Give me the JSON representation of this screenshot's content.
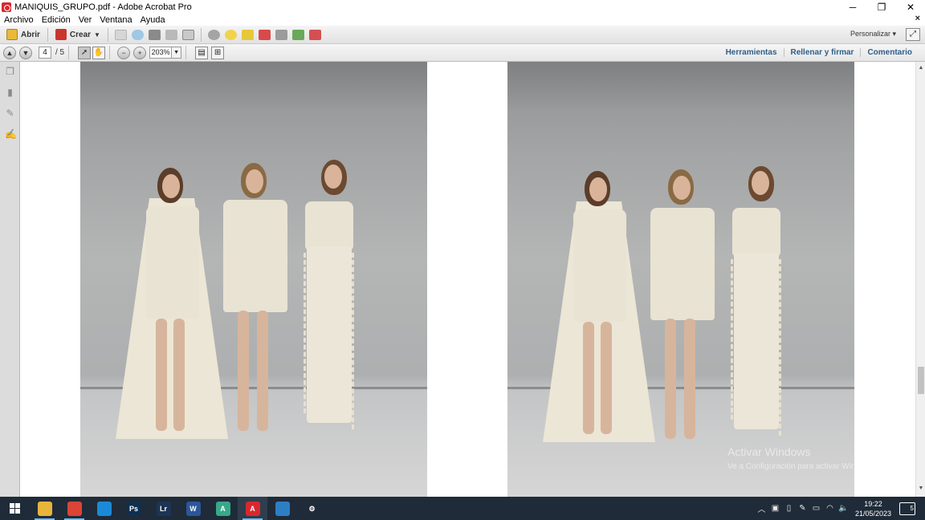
{
  "window": {
    "title": "MANIQUIS_GRUPO.pdf - Adobe Acrobat Pro",
    "controls": {
      "minimize": "─",
      "restore": "❐",
      "close": "✕"
    }
  },
  "menu": {
    "items": [
      "Archivo",
      "Edición",
      "Ver",
      "Ventana",
      "Ayuda"
    ],
    "close_doc": "×"
  },
  "toolbar": {
    "open_label": "Abrir",
    "create_label": "Crear",
    "customize_label": "Personalizar",
    "icon_names": [
      "save-icon",
      "cloud-upload-icon",
      "print-icon",
      "edit-icon",
      "email-icon",
      "settings-icon",
      "comment-icon",
      "highlight-icon",
      "delete-page-icon",
      "extract-icon",
      "insert-icon",
      "export-icon"
    ]
  },
  "nav": {
    "current_page": "4",
    "total_pages": "/ 5",
    "zoom": "203%",
    "links": [
      "Herramientas",
      "Rellenar y firmar",
      "Comentario"
    ]
  },
  "document": {
    "pages": [
      {
        "name": "photo-left",
        "description_visible": false
      },
      {
        "name": "photo-right",
        "description_visible": false
      }
    ]
  },
  "overlay": {
    "activation_title": "Activar Windows",
    "activation_sub": "Ve a Configuración para activar Windows."
  },
  "taskbar": {
    "apps": [
      {
        "name": "file-explorer-icon",
        "label": "",
        "color": "#e7b53a",
        "active": false,
        "open": true
      },
      {
        "name": "chrome-icon",
        "label": "",
        "color": "#db4437",
        "active": false,
        "open": true
      },
      {
        "name": "edge-icon",
        "label": "",
        "color": "#1b8ad6",
        "active": false,
        "open": false
      },
      {
        "name": "photoshop-icon",
        "label": "Ps",
        "color": "#0f2f4e",
        "active": false,
        "open": false
      },
      {
        "name": "lightroom-icon",
        "label": "Lr",
        "color": "#1c3455",
        "active": false,
        "open": false
      },
      {
        "name": "word-icon",
        "label": "W",
        "color": "#2b579a",
        "active": false,
        "open": false
      },
      {
        "name": "access-icon",
        "label": "A",
        "color": "#39a88a",
        "active": false,
        "open": false
      },
      {
        "name": "acrobat-icon",
        "label": "A",
        "color": "#d8282f",
        "active": true,
        "open": true
      },
      {
        "name": "photos-icon",
        "label": "",
        "color": "#2d7fc4",
        "active": false,
        "open": false
      },
      {
        "name": "settings-app-icon",
        "label": "⚙",
        "color": "#1f2b38",
        "active": false,
        "open": false
      }
    ],
    "time": "19:22",
    "date": "21/05/2023",
    "notifications": "5"
  }
}
